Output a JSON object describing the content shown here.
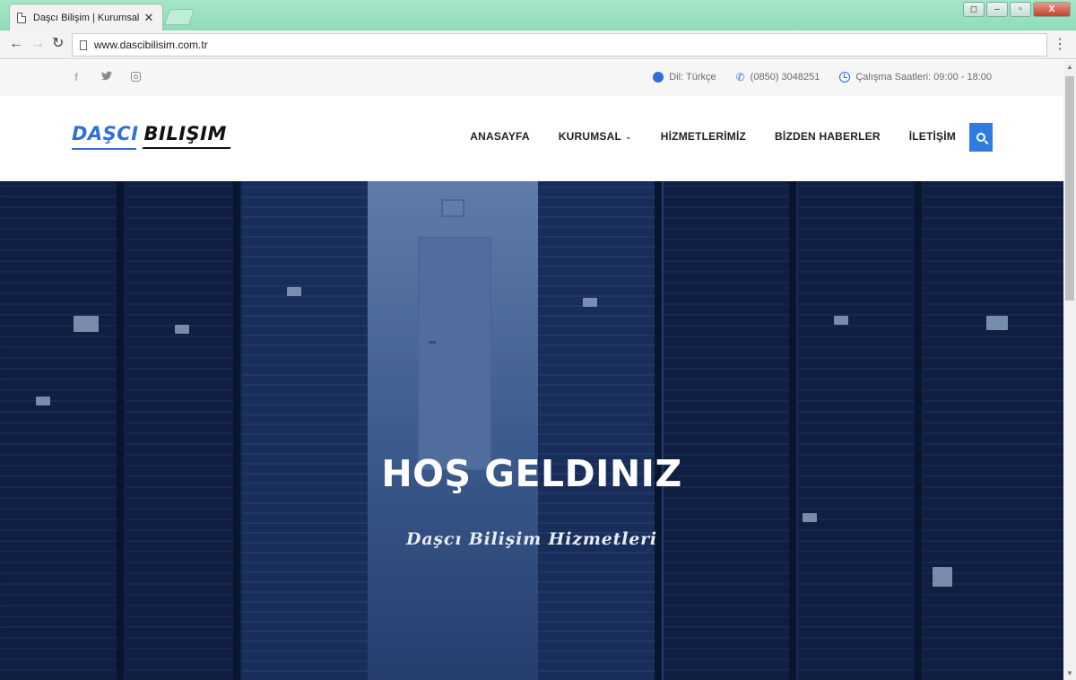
{
  "browser": {
    "tab_title": "Daşcı Bilişim | Kurumsal W",
    "url": "www.dascibilisim.com.tr",
    "window_controls": {
      "user": "◻",
      "minimize": "–",
      "maximize": "▫",
      "close": "X"
    },
    "menu_icon": "⋮"
  },
  "topbar": {
    "social": {
      "facebook": "f",
      "twitter": "🐦︎",
      "instagram": ""
    },
    "language_label": "Dil: Türkçe",
    "phone": "(0850) 3048251",
    "hours": "Çalışma Saatleri: 09:00 - 18:00"
  },
  "logo": {
    "part1": "DAŞCI",
    "part2": "BILIŞIM"
  },
  "nav": {
    "items": [
      "ANASAYFA",
      "KURUMSAL",
      "HİZMETLERİMİZ",
      "BİZDEN HABERLER",
      "İLETİŞİM"
    ],
    "caret": "⌄"
  },
  "hero": {
    "title": "HOŞ GELDINIZ",
    "subtitle": "Daşcı Bilişim Hizmetleri"
  },
  "colors": {
    "accent": "#2f6fd6",
    "hero_overlay": "#162c5c",
    "chrome": "#9ee2c2"
  },
  "icons": [
    "page-icon",
    "close-icon",
    "back-icon",
    "forward-icon",
    "reload-icon",
    "facebook-icon",
    "twitter-icon",
    "instagram-icon",
    "globe-icon",
    "phone-icon",
    "clock-icon",
    "search-icon"
  ]
}
